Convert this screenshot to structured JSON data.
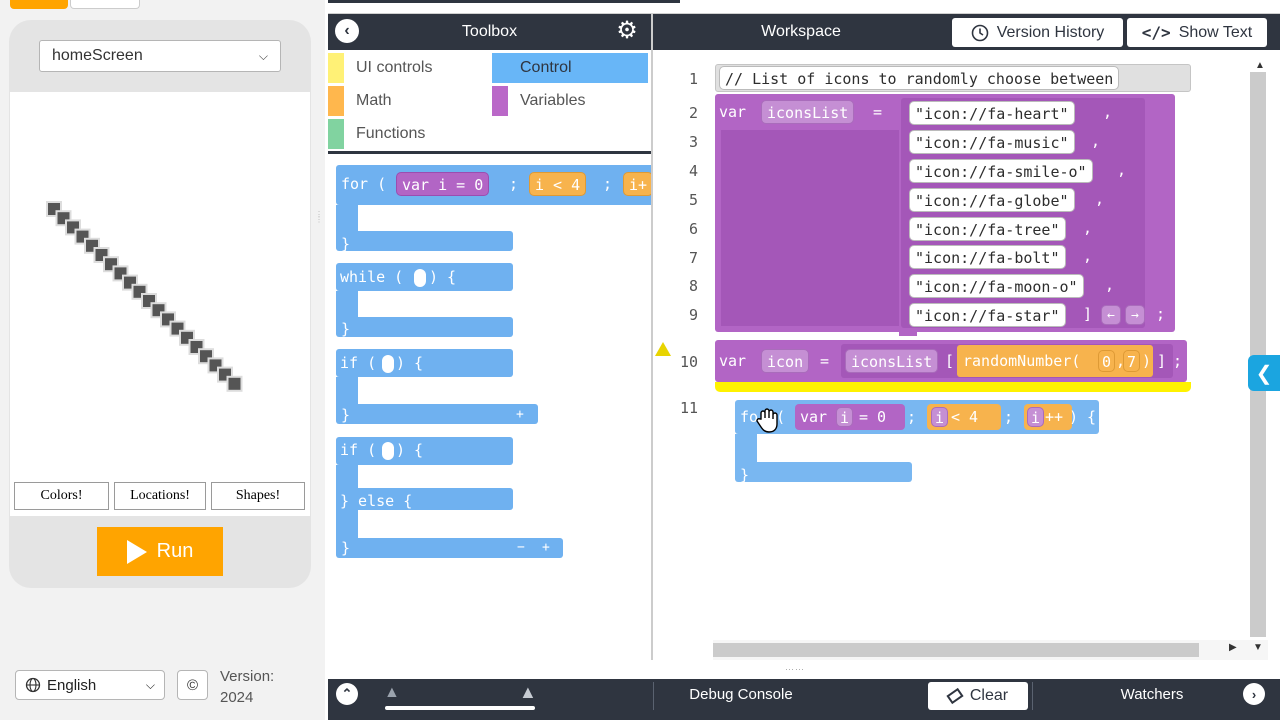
{
  "left_panel": {
    "screen_select": "homeScreen",
    "app_buttons": [
      "Colors!",
      "Locations!",
      "Shapes!"
    ],
    "run_label": "Run",
    "language": "English",
    "version_label": "Version:",
    "version_value": "2024",
    "icon_names": [
      "chevron-down-icon",
      "globe-icon",
      "copyright-icon",
      "play-icon"
    ]
  },
  "toolbox": {
    "title": "Toolbox",
    "categories": [
      {
        "label": "UI controls",
        "color": "#fff176"
      },
      {
        "label": "Control",
        "color": "#68b6f7",
        "selected": true
      },
      {
        "label": "Math",
        "color": "#ffb74d"
      },
      {
        "label": "Variables",
        "color": "#ba68c8"
      },
      {
        "label": "Functions",
        "color": "#81d3a0"
      }
    ],
    "palette": {
      "for_kw": "for (",
      "for_var": "var i = 0",
      "semi": ";",
      "for_cond": "i < 4",
      "for_inc": "i+",
      "close_brace": "}",
      "while_kw": "while (",
      "if_kw": "if (",
      "paren_open_brace": ") {",
      "else_kw": "} else {",
      "plus": "+",
      "minus": "−"
    }
  },
  "workspace": {
    "title": "Workspace",
    "version_history_label": "Version History",
    "show_text_label": "Show Text",
    "line_numbers": [
      "1",
      "2",
      "3",
      "4",
      "5",
      "6",
      "7",
      "8",
      "9",
      "10",
      "11"
    ],
    "comment": "// List of icons to randomly choose between",
    "var_kw": "var",
    "icons_list_name": "iconsList",
    "equals": "=",
    "icons": [
      "\"icon://fa-heart\"",
      "\"icon://fa-music\"",
      "\"icon://fa-smile-o\"",
      "\"icon://fa-globe\"",
      "\"icon://fa-tree\"",
      "\"icon://fa-bolt\"",
      "\"icon://fa-moon-o\"",
      "\"icon://fa-star\""
    ],
    "arr_open": "[",
    "arr_close": "]",
    "comma": ",",
    "semicolon": ";",
    "arrow_left": "←",
    "arrow_right": "→",
    "icon_var": "icon",
    "random_call": "randomNumber(",
    "random_min": "0",
    "random_sep": ",",
    "random_max": "7",
    "random_close": ")",
    "for_kw": "for (",
    "for_var": "var",
    "for_i": "i",
    "for_eq": "= 0",
    "for_lt": "< 4",
    "for_inc": "++",
    "for_close": ") {",
    "close_brace": "}"
  },
  "bottom_bar": {
    "debug_label": "Debug Console",
    "clear_label": "Clear",
    "watchers_label": "Watchers"
  },
  "colors": {
    "header": "#2f3540",
    "control_block": "#6fb1f0",
    "variable_block": "#b265c5",
    "math_block": "#f7b34d",
    "run_button": "#ffa400",
    "insert_marker": "#fff200",
    "collapse_tab": "#1ba5e0"
  }
}
